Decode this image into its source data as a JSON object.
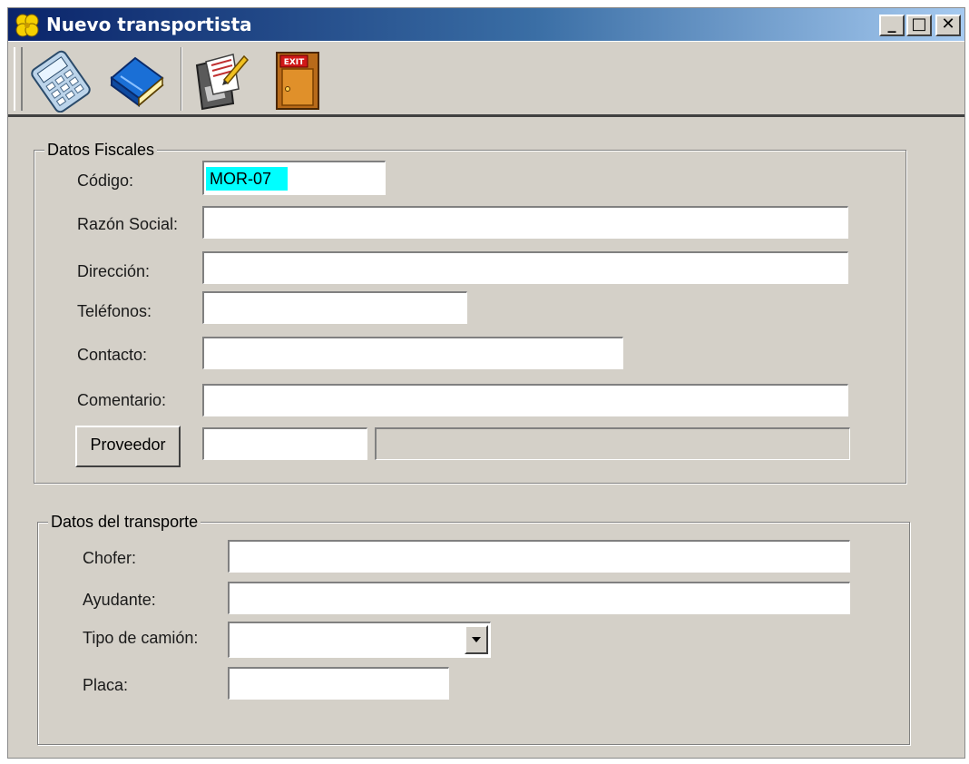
{
  "window": {
    "title": "Nuevo transportista",
    "controls": {
      "minimize": "_",
      "maximize": "□",
      "close": "✕"
    }
  },
  "toolbar": {
    "tools": [
      {
        "name": "calculator-icon"
      },
      {
        "name": "book-icon"
      },
      {
        "name": "save-icon"
      },
      {
        "name": "exit-icon",
        "badge": "EXIT"
      }
    ]
  },
  "fiscal": {
    "legend": "Datos  Fiscales",
    "codigo_label": "Código:",
    "codigo_value": "MOR-07",
    "razon_label": "Razón Social:",
    "razon_value": "",
    "direccion_label": "Dirección:",
    "direccion_value": "",
    "telefonos_label": "Teléfonos:",
    "telefonos_value": "",
    "contacto_label": "Contacto:",
    "contacto_value": "",
    "comentario_label": "Comentario:",
    "comentario_value": "",
    "proveedor_button": "Proveedor",
    "proveedor_code": "",
    "proveedor_name": ""
  },
  "transporte": {
    "legend": "Datos del transporte",
    "chofer_label": "Chofer:",
    "chofer_value": "",
    "ayudante_label": "Ayudante:",
    "ayudante_value": "",
    "tipo_label": "Tipo de camión:",
    "tipo_value": "",
    "placa_label": "Placa:",
    "placa_value": ""
  },
  "colors": {
    "window_bg": "#d4d0c8",
    "title_start": "#0a246a",
    "title_end": "#a6caf0",
    "code_highlight": "#00ffff"
  }
}
